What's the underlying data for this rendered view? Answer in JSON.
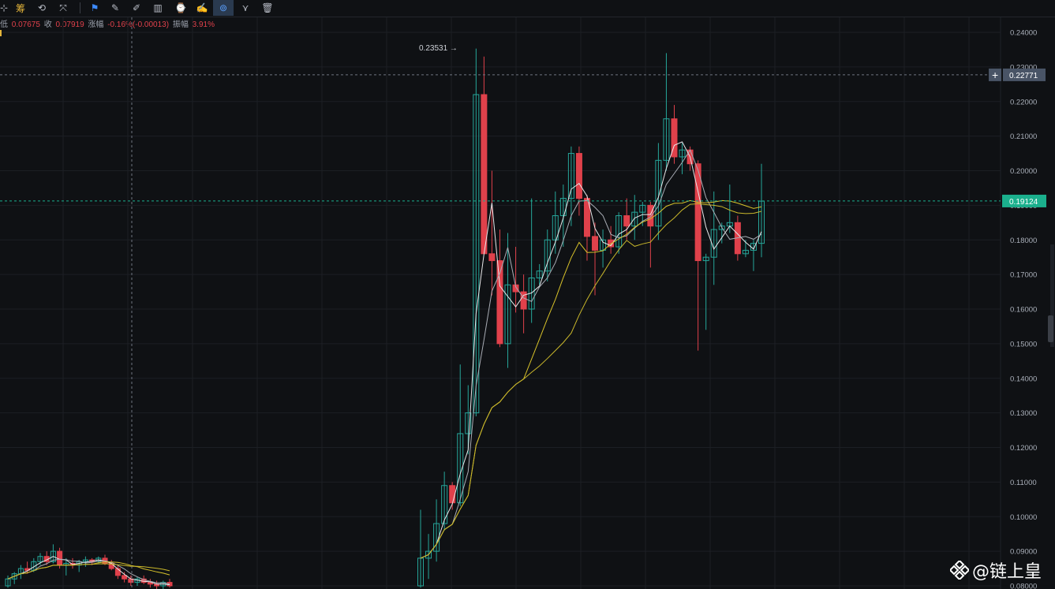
{
  "toolbar": {
    "items": [
      {
        "icon": "crosshair-icon",
        "glyph": "⊹"
      },
      {
        "icon": "chips-icon",
        "glyph": "筹"
      },
      {
        "icon": "replay-icon",
        "glyph": "⟲"
      },
      {
        "icon": "indicator-icon",
        "glyph": "⤧"
      },
      {
        "icon": "bookmark-icon",
        "glyph": "⚑"
      },
      {
        "icon": "ruler-icon",
        "glyph": "✎"
      },
      {
        "icon": "brush-icon",
        "glyph": "✐"
      },
      {
        "icon": "candles-icon",
        "glyph": "▥"
      },
      {
        "icon": "clock-icon",
        "glyph": "⌚"
      },
      {
        "icon": "edit-icon",
        "glyph": "✍"
      },
      {
        "icon": "magnet-icon",
        "glyph": "⊚"
      },
      {
        "icon": "filter-icon",
        "glyph": "⋎"
      },
      {
        "icon": "trash-icon",
        "glyph": "🗑"
      }
    ]
  },
  "info": {
    "low_label": "低",
    "low_value": "0.07675",
    "close_label": "收",
    "close_value": "0.07919",
    "change_label": "涨幅",
    "change_value": "-0.16%(-0.00013)",
    "amplitude_label": "振幅",
    "amplitude_value": "3.91%"
  },
  "badges": {
    "cursor_price": "0.22771",
    "last_price": "0.19124",
    "high_annotation": "0.23531 →"
  },
  "watermark": "@链上皇",
  "colors": {
    "up": "#26a69a",
    "down": "#e0414b",
    "ma_white": "#e8e8ea",
    "ma_grey": "#a9adb5",
    "ma_yellow": "#d8c22a",
    "ma_yellow2": "#c9b72b",
    "grid": "#1c1f24",
    "last_badge": "#1bb08d",
    "cursor_badge": "#495466"
  },
  "chart_data": {
    "type": "candlestick",
    "y_ticks": [
      "0.24000",
      "0.23000",
      "0.22000",
      "0.21000",
      "0.20000",
      "0.19000",
      "0.18000",
      "0.17000",
      "0.16000",
      "0.15000",
      "0.14000",
      "0.13000",
      "0.12000",
      "0.11000",
      "0.10000",
      "0.09000",
      "0.08000"
    ],
    "ylim": [
      0.0795,
      0.2435
    ],
    "candles": [
      [
        0.08,
        0.083,
        0.0795,
        0.082
      ],
      [
        0.082,
        0.084,
        0.0805,
        0.0835
      ],
      [
        0.0835,
        0.086,
        0.082,
        0.085
      ],
      [
        0.085,
        0.087,
        0.0835,
        0.0845
      ],
      [
        0.0845,
        0.088,
        0.084,
        0.087
      ],
      [
        0.087,
        0.0895,
        0.086,
        0.0885
      ],
      [
        0.0885,
        0.09,
        0.086,
        0.087
      ],
      [
        0.087,
        0.092,
        0.0865,
        0.09
      ],
      [
        0.09,
        0.091,
        0.085,
        0.086
      ],
      [
        0.086,
        0.088,
        0.083,
        0.0865
      ],
      [
        0.0865,
        0.088,
        0.085,
        0.086
      ],
      [
        0.086,
        0.0875,
        0.084,
        0.087
      ],
      [
        0.087,
        0.0885,
        0.0855,
        0.0875
      ],
      [
        0.0875,
        0.088,
        0.086,
        0.087
      ],
      [
        0.087,
        0.0885,
        0.0865,
        0.088
      ],
      [
        0.088,
        0.089,
        0.086,
        0.0865
      ],
      [
        0.0865,
        0.0875,
        0.0845,
        0.085
      ],
      [
        0.085,
        0.086,
        0.082,
        0.083
      ],
      [
        0.083,
        0.084,
        0.081,
        0.082
      ],
      [
        0.082,
        0.083,
        0.08,
        0.081
      ],
      [
        0.081,
        0.0825,
        0.08,
        0.082
      ],
      [
        0.082,
        0.083,
        0.0805,
        0.081
      ],
      [
        0.081,
        0.082,
        0.0795,
        0.0805
      ],
      [
        0.0805,
        0.0815,
        0.079,
        0.08
      ],
      [
        0.08,
        0.0815,
        0.079,
        0.081
      ],
      [
        0.081,
        0.082,
        0.0795,
        0.08
      ]
    ],
    "candles2": [
      [
        0.08,
        0.102,
        0.0795,
        0.088
      ],
      [
        0.088,
        0.095,
        0.082,
        0.09
      ],
      [
        0.09,
        0.105,
        0.087,
        0.098
      ],
      [
        0.098,
        0.113,
        0.096,
        0.109
      ],
      [
        0.109,
        0.11,
        0.102,
        0.104
      ],
      [
        0.104,
        0.144,
        0.103,
        0.124
      ],
      [
        0.124,
        0.138,
        0.118,
        0.13
      ],
      [
        0.13,
        0.2353,
        0.129,
        0.222
      ],
      [
        0.222,
        0.233,
        0.18,
        0.176
      ],
      [
        0.176,
        0.2,
        0.164,
        0.174
      ],
      [
        0.174,
        0.183,
        0.149,
        0.15
      ],
      [
        0.15,
        0.182,
        0.143,
        0.167
      ],
      [
        0.167,
        0.178,
        0.159,
        0.165
      ],
      [
        0.165,
        0.17,
        0.153,
        0.16
      ],
      [
        0.16,
        0.192,
        0.156,
        0.169
      ],
      [
        0.169,
        0.173,
        0.167,
        0.171
      ],
      [
        0.171,
        0.183,
        0.168,
        0.18
      ],
      [
        0.18,
        0.194,
        0.176,
        0.187
      ],
      [
        0.187,
        0.196,
        0.178,
        0.192
      ],
      [
        0.192,
        0.207,
        0.184,
        0.205
      ],
      [
        0.205,
        0.207,
        0.187,
        0.192
      ],
      [
        0.192,
        0.193,
        0.174,
        0.181
      ],
      [
        0.181,
        0.185,
        0.164,
        0.177
      ],
      [
        0.177,
        0.183,
        0.172,
        0.18
      ],
      [
        0.18,
        0.184,
        0.176,
        0.178
      ],
      [
        0.178,
        0.188,
        0.176,
        0.187
      ],
      [
        0.187,
        0.192,
        0.18,
        0.184
      ],
      [
        0.184,
        0.193,
        0.18,
        0.188
      ],
      [
        0.188,
        0.191,
        0.184,
        0.19
      ],
      [
        0.19,
        0.191,
        0.172,
        0.184
      ],
      [
        0.184,
        0.208,
        0.18,
        0.203
      ],
      [
        0.203,
        0.234,
        0.2,
        0.215
      ],
      [
        0.215,
        0.219,
        0.202,
        0.204
      ],
      [
        0.204,
        0.208,
        0.199,
        0.206
      ],
      [
        0.206,
        0.207,
        0.2,
        0.202
      ],
      [
        0.202,
        0.203,
        0.148,
        0.174
      ],
      [
        0.174,
        0.176,
        0.154,
        0.175
      ],
      [
        0.175,
        0.194,
        0.167,
        0.183
      ],
      [
        0.183,
        0.185,
        0.179,
        0.184
      ],
      [
        0.184,
        0.196,
        0.182,
        0.185
      ],
      [
        0.185,
        0.187,
        0.174,
        0.176
      ],
      [
        0.176,
        0.18,
        0.175,
        0.177
      ],
      [
        0.177,
        0.18,
        0.171,
        0.179
      ],
      [
        0.179,
        0.202,
        0.175,
        0.1912
      ]
    ]
  }
}
